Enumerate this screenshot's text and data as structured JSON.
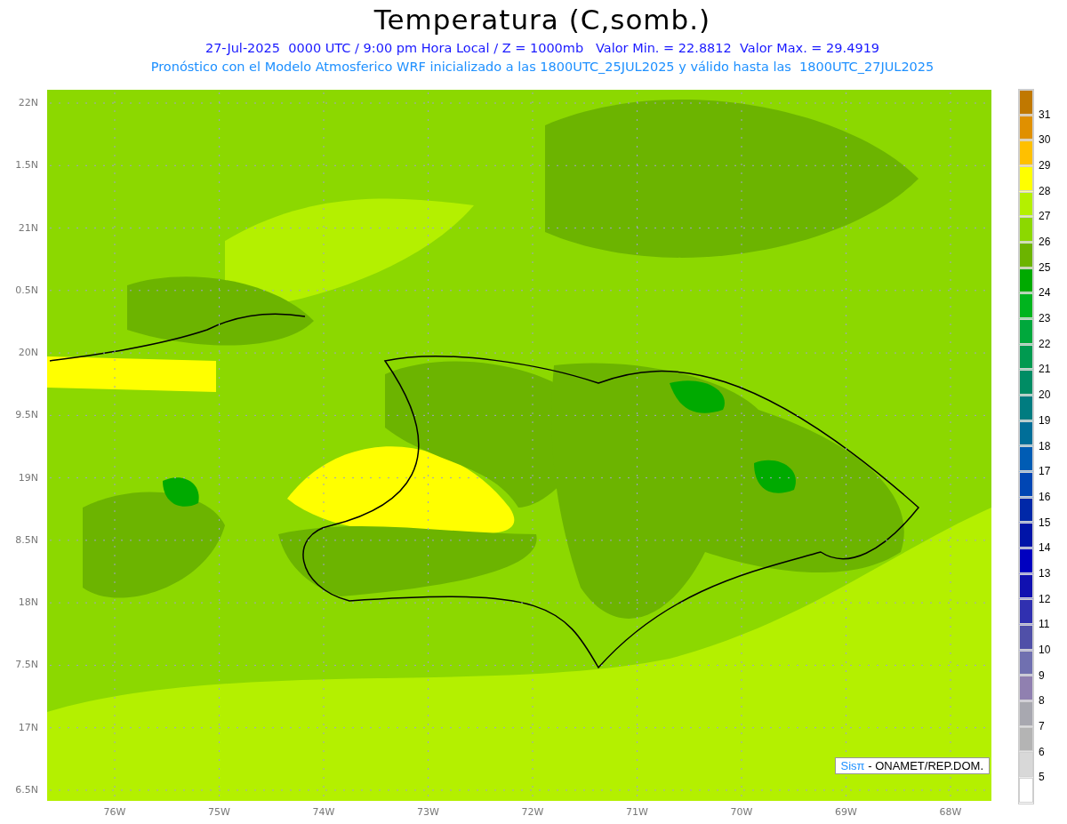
{
  "title": "Temperatura (C,somb.)",
  "subtitle": "27-Jul-2025  0000 UTC / 9:00 pm Hora Local / Z = 1000mb   Valor Min. = 22.8812  Valor Max. = 29.4919",
  "description": "Pronóstico con el Modelo Atmosferico WRF inicializado a las 1800UTC_25JUL2025 y válido hasta las  1800UTC_27JUL2025",
  "map": {
    "y_ticks": [
      "22N",
      "1.5N",
      "21N",
      "0.5N",
      "20N",
      "9.5N",
      "19N",
      "8.5N",
      "18N",
      "7.5N",
      "17N",
      "6.5N"
    ],
    "x_ticks": [
      "76W",
      "75W",
      "74W",
      "73W",
      "72W",
      "71W",
      "70W",
      "69W",
      "68W"
    ],
    "credit": {
      "logo": "Sisπ",
      "text": "- ONAMET/REP.DOM."
    }
  },
  "colorbar": {
    "bins": [
      {
        "color": "#c07800"
      },
      {
        "color": "#e09000"
      },
      {
        "color": "#ffc000"
      },
      {
        "color": "#ffff00"
      },
      {
        "color": "#b4f000"
      },
      {
        "color": "#8cd800"
      },
      {
        "color": "#6cb400"
      },
      {
        "color": "#00aa00"
      },
      {
        "color": "#00b41e"
      },
      {
        "color": "#00a83c"
      },
      {
        "color": "#009a50"
      },
      {
        "color": "#008c64"
      },
      {
        "color": "#007c80"
      },
      {
        "color": "#006e98"
      },
      {
        "color": "#005cb4"
      },
      {
        "color": "#0046b4"
      },
      {
        "color": "#0028a8"
      },
      {
        "color": "#0014a8"
      },
      {
        "color": "#0000c0"
      },
      {
        "color": "#1010b0"
      },
      {
        "color": "#3030b0"
      },
      {
        "color": "#5050a8"
      },
      {
        "color": "#7070b0"
      },
      {
        "color": "#9080b0"
      },
      {
        "color": "#a8a8b0"
      },
      {
        "color": "#b4b4b4"
      },
      {
        "color": "#d8d8d8"
      },
      {
        "color": "#ffffff"
      }
    ],
    "labels": [
      "31",
      "30",
      "29",
      "28",
      "27",
      "26",
      "25",
      "24",
      "23",
      "22",
      "21",
      "20",
      "19",
      "18",
      "17",
      "16",
      "15",
      "14",
      "13",
      "12",
      "11",
      "10",
      "9",
      "8",
      "7",
      "6",
      "5"
    ]
  }
}
